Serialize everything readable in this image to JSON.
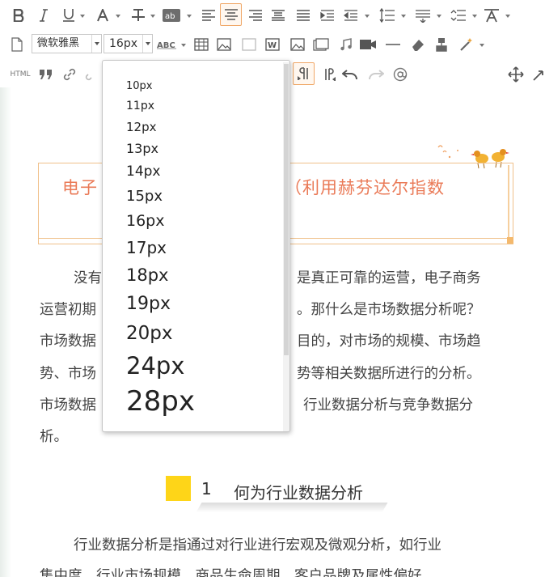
{
  "toolbar": {
    "font_family_value": "微软雅黑",
    "font_size_value": "16px",
    "html_label": "HTML",
    "icons": [
      "bold-icon",
      "italic-icon",
      "underline-icon",
      "font-color-icon",
      "strikethrough-icon",
      "background-color-icon",
      "align-left-icon",
      "align-center-icon",
      "align-right-icon",
      "justify-icon",
      "indent-icon",
      "outdent-icon",
      "line-height-icon",
      "paragraph-spacing-icon",
      "clear-format-icon",
      "document-icon",
      "letter-spacing-icon",
      "table-icon",
      "image-icon",
      "word-icon",
      "picture-icon",
      "gallery-icon",
      "music-icon",
      "video-icon",
      "horizontal-rule-icon",
      "eraser-icon",
      "format-brush-icon",
      "magic-wand-icon",
      "quote-icon",
      "link-icon",
      "ltr-icon",
      "rtl-icon",
      "undo-icon",
      "redo-icon",
      "at-icon",
      "move-icon",
      "fullscreen-icon"
    ]
  },
  "font_size_dropdown": {
    "options": [
      "10px",
      "11px",
      "12px",
      "13px",
      "14px",
      "15px",
      "16px",
      "17px",
      "18px",
      "19px",
      "20px",
      "24px",
      "28px"
    ]
  },
  "document": {
    "title_left": "电子",
    "title_right": "析（利用赫芬达尔指数",
    "paragraph1_lines": [
      [
        "没有",
        "是真正可靠的运营，电子商务"
      ],
      [
        "运营初期",
        "。那什么是市场数据分析呢？"
      ],
      [
        "市场数据",
        "目的，对市场的规模、市场趋"
      ],
      [
        "势、市场",
        "势等相关数据所进行的分析。"
      ],
      [
        "市场数据",
        "行业数据分析与竞争数据分"
      ],
      [
        "析。",
        ""
      ]
    ],
    "section_number": "1",
    "section_title": "何为行业数据分析",
    "paragraph2_lines": [
      "行业数据分析是指通过对行业进行宏观及微观分析，如行业",
      "集中度、行业市场规模、商品生命周期、客户品牌及属性偏好"
    ]
  },
  "colors": {
    "title_text": "#ea7a57",
    "title_border": "#f0c08a",
    "section_block": "#fed518",
    "active_button_border": "#f0a868"
  }
}
